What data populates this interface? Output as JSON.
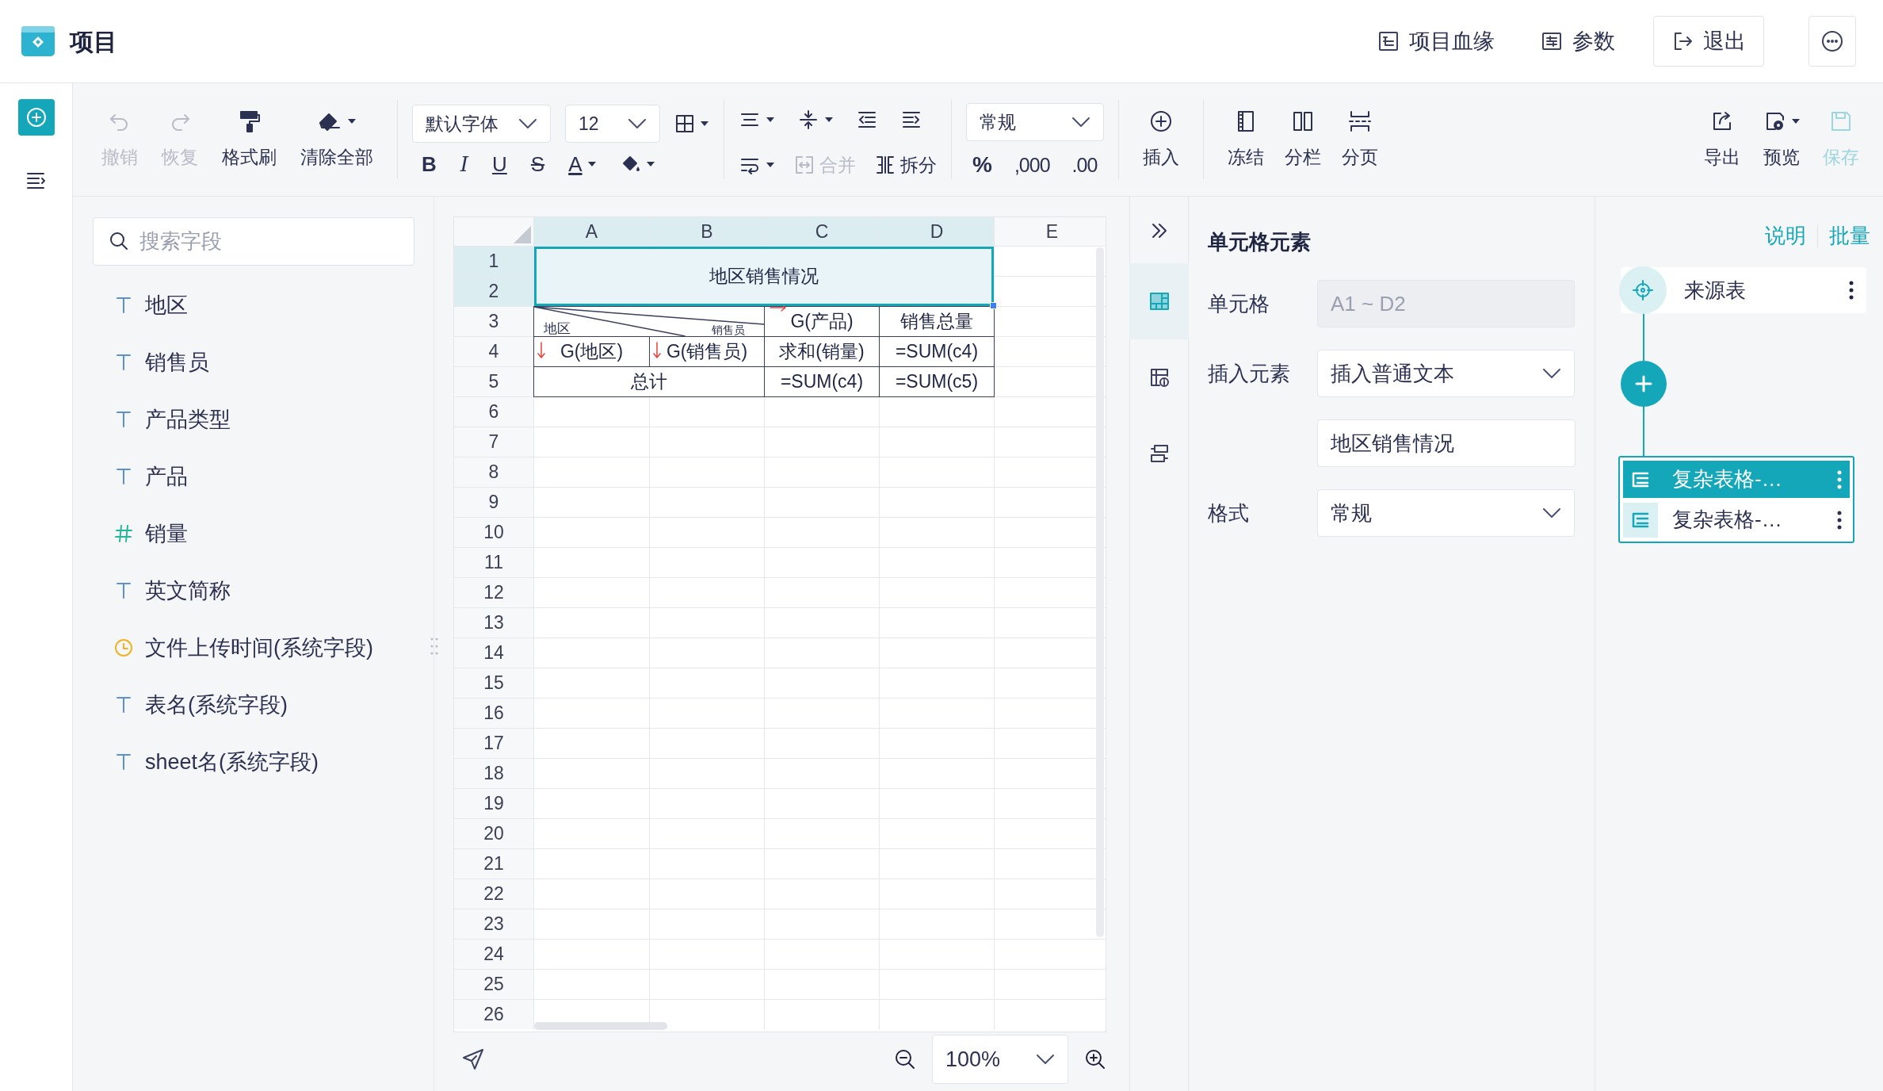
{
  "app": {
    "title": "项目"
  },
  "header_actions": [
    {
      "label": "项目血缘",
      "kind": "lineage"
    },
    {
      "label": "参数",
      "kind": "params"
    },
    {
      "label": "退出",
      "kind": "exit"
    }
  ],
  "toolbar": {
    "history": [
      {
        "label": "撤销",
        "disabled": true
      },
      {
        "label": "恢复",
        "disabled": true
      },
      {
        "label": "格式刷",
        "disabled": false
      },
      {
        "label": "清除全部",
        "disabled": false
      }
    ],
    "font": {
      "value": "默认字体"
    },
    "size": {
      "value": "12"
    },
    "text_styles": [
      "B",
      "I",
      "U",
      "S",
      "A"
    ],
    "merge": {
      "label": "合并",
      "disabled": true
    },
    "split": {
      "label": "拆分",
      "disabled": false
    },
    "number_format": {
      "value": "常规"
    },
    "number_buttons": [
      "%",
      ",000",
      ".00"
    ],
    "insert": {
      "label": "插入"
    },
    "layout": [
      {
        "label": "冻结"
      },
      {
        "label": "分栏"
      },
      {
        "label": "分页"
      }
    ],
    "file": [
      {
        "label": "导出",
        "disabled": false
      },
      {
        "label": "预览",
        "disabled": false
      },
      {
        "label": "保存",
        "disabled": true
      }
    ]
  },
  "fields_panel": {
    "search": {
      "placeholder": "搜索字段"
    },
    "fields": [
      {
        "label": "地区",
        "kind": "text"
      },
      {
        "label": "销售员",
        "kind": "text"
      },
      {
        "label": "产品类型",
        "kind": "text"
      },
      {
        "label": "产品",
        "kind": "text"
      },
      {
        "label": "销量",
        "kind": "number"
      },
      {
        "label": "英文简称",
        "kind": "text"
      },
      {
        "label": "文件上传时间(系统字段)",
        "kind": "time"
      },
      {
        "label": "表名(系统字段)",
        "kind": "text"
      },
      {
        "label": "sheet名(系统字段)",
        "kind": "text"
      }
    ]
  },
  "sheet": {
    "columns": [
      {
        "label": "A",
        "selected": true
      },
      {
        "label": "B",
        "selected": true
      },
      {
        "label": "C",
        "selected": true
      },
      {
        "label": "D",
        "selected": true
      },
      {
        "label": "E",
        "selected": false
      }
    ],
    "rows": [
      {
        "label": "1",
        "selected": true
      },
      {
        "label": "2",
        "selected": true
      },
      {
        "label": "3",
        "selected": false
      },
      {
        "label": "4",
        "selected": false
      },
      {
        "label": "5",
        "selected": false
      },
      {
        "label": "6",
        "selected": false
      },
      {
        "label": "7",
        "selected": false
      },
      {
        "label": "8",
        "selected": false
      },
      {
        "label": "9",
        "selected": false
      },
      {
        "label": "10",
        "selected": false
      },
      {
        "label": "11",
        "selected": false
      },
      {
        "label": "12",
        "selected": false
      },
      {
        "label": "13",
        "selected": false
      },
      {
        "label": "14",
        "selected": false
      },
      {
        "label": "15",
        "selected": false
      },
      {
        "label": "16",
        "selected": false
      },
      {
        "label": "17",
        "selected": false
      },
      {
        "label": "18",
        "selected": false
      },
      {
        "label": "19",
        "selected": false
      },
      {
        "label": "20",
        "selected": false
      },
      {
        "label": "21",
        "selected": false
      },
      {
        "label": "22",
        "selected": false
      },
      {
        "label": "23",
        "selected": false
      },
      {
        "label": "24",
        "selected": false
      },
      {
        "label": "25",
        "selected": false
      },
      {
        "label": "26",
        "selected": false
      }
    ],
    "cells": [
      {
        "kind": "text",
        "text": "地区销售情况",
        "selected": true,
        "expand_down": false,
        "expand_right": false
      },
      {
        "kind": "diagonal",
        "labels": [
          "地区",
          "销售员"
        ],
        "selected": false
      },
      {
        "kind": "text",
        "text": "G(产品)",
        "selected": false,
        "expand_down": false,
        "expand_right": true
      },
      {
        "kind": "text",
        "text": "销售总量",
        "selected": false,
        "expand_down": false,
        "expand_right": false
      },
      {
        "kind": "text",
        "text": "G(地区)",
        "selected": false,
        "expand_down": true,
        "expand_right": false
      },
      {
        "kind": "text",
        "text": "G(销售员)",
        "selected": false,
        "expand_down": true,
        "expand_right": false
      },
      {
        "kind": "text",
        "text": "求和(销量)",
        "selected": false,
        "expand_down": false,
        "expand_right": false
      },
      {
        "kind": "text",
        "text": "=SUM(c4)",
        "selected": false,
        "expand_down": false,
        "expand_right": false
      },
      {
        "kind": "text",
        "text": "总计",
        "selected": false,
        "expand_down": false,
        "expand_right": false
      },
      {
        "kind": "text",
        "text": "=SUM(c4)",
        "selected": false,
        "expand_down": false,
        "expand_right": false
      },
      {
        "kind": "text",
        "text": "=SUM(c5)",
        "selected": false,
        "expand_down": false,
        "expand_right": false
      }
    ],
    "zoom": {
      "value": "100%"
    }
  },
  "side_tabs": [
    {
      "kind": "cell",
      "selected": true
    },
    {
      "kind": "info",
      "selected": false
    },
    {
      "kind": "layout",
      "selected": false
    }
  ],
  "properties": {
    "title": "单元格元素",
    "fields": [
      {
        "label": "单元格",
        "kind": "readonly",
        "value": "A1 ~ D2"
      },
      {
        "label": "插入元素",
        "kind": "select",
        "value": "插入普通文本"
      },
      {
        "kind": "input",
        "value": "地区销售情况"
      },
      {
        "label": "格式",
        "kind": "select",
        "value": "常规"
      }
    ]
  },
  "flow": {
    "links": [
      "说明",
      "批量"
    ],
    "source": {
      "label": "来源表"
    },
    "outputs": [
      {
        "label": "复杂表格-…",
        "selected": true
      },
      {
        "label": "复杂表格-…",
        "selected": false
      }
    ]
  }
}
